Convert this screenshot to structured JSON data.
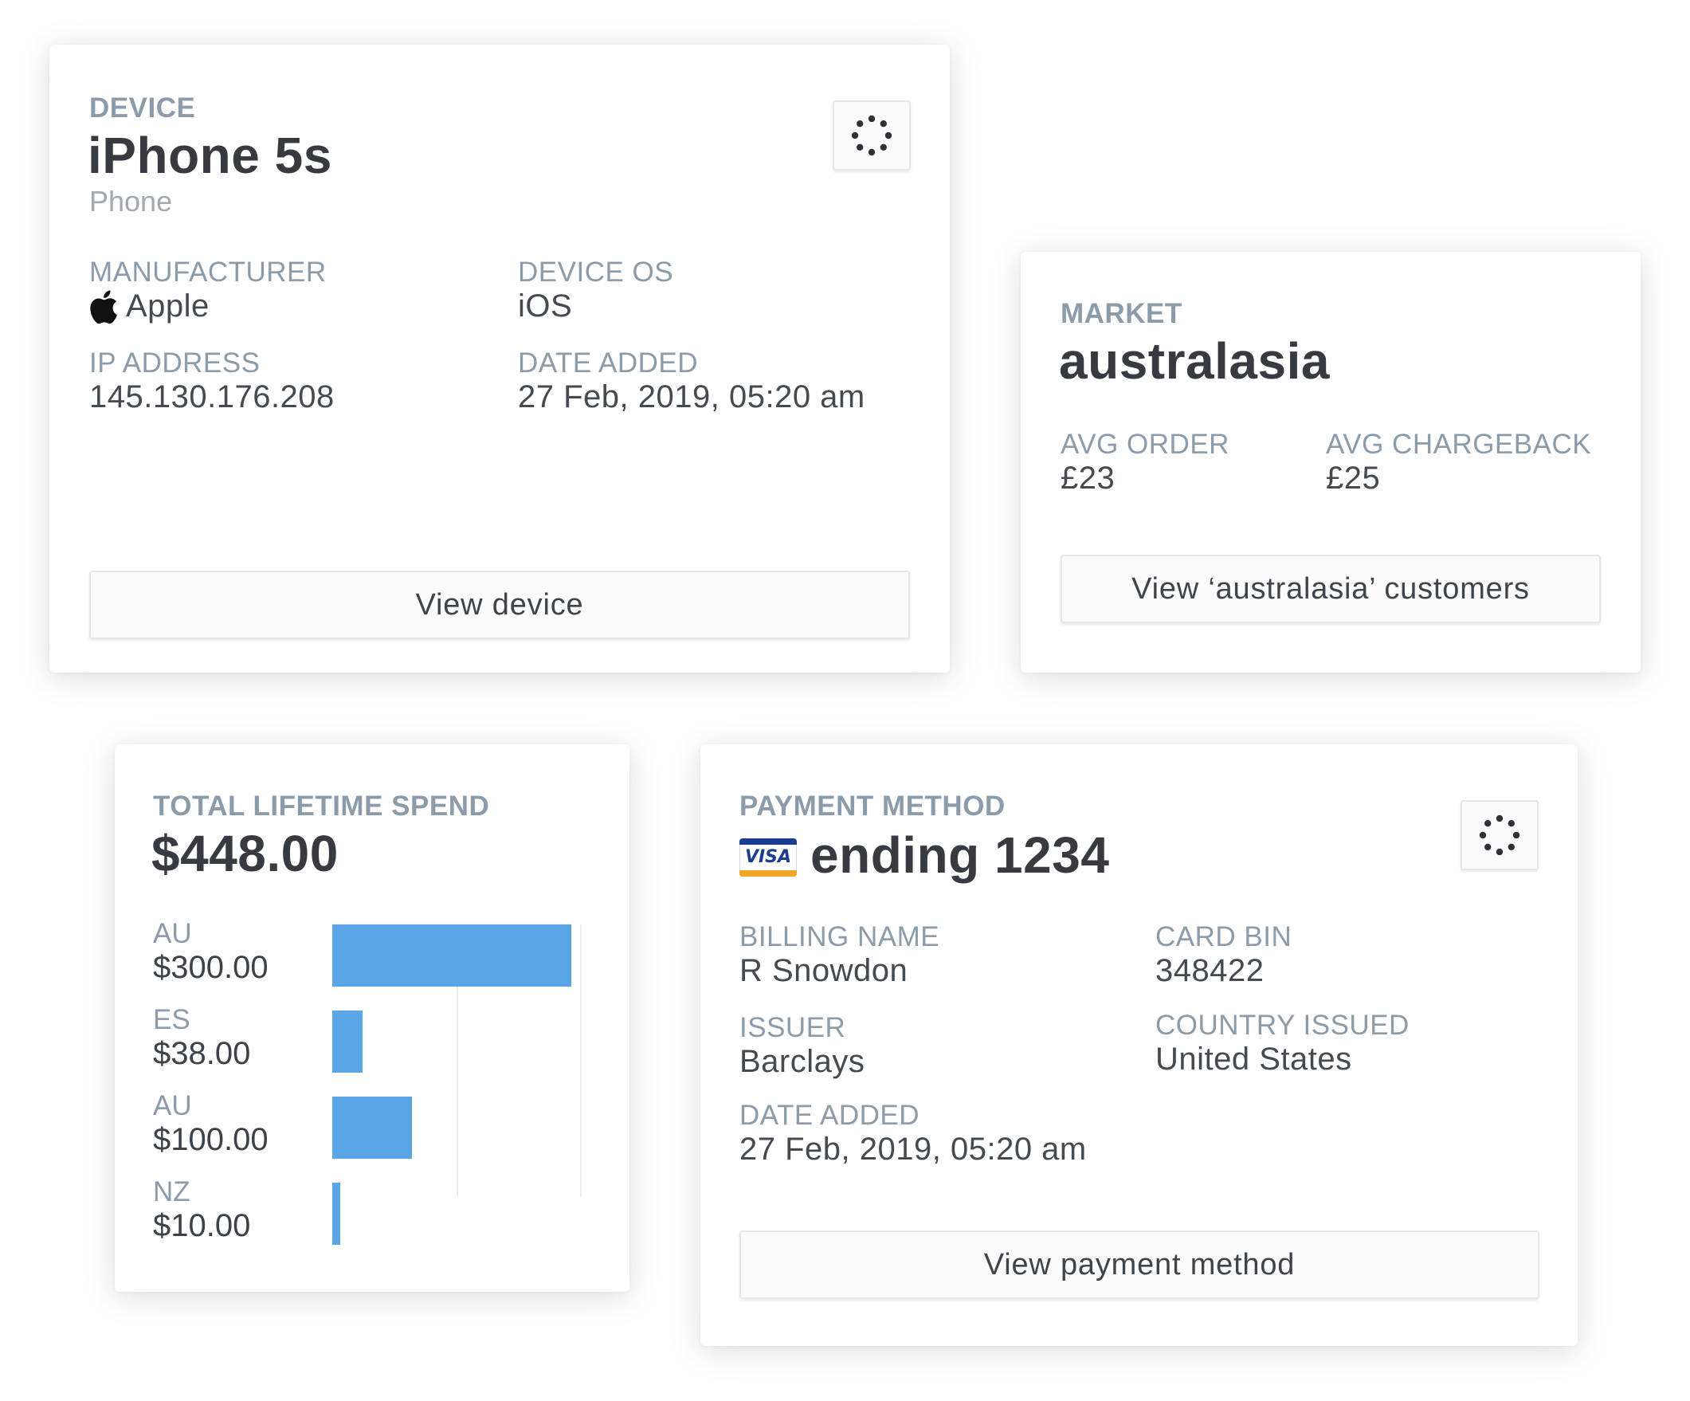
{
  "device_card": {
    "eyebrow": "DEVICE",
    "title": "iPhone 5s",
    "subtitle": "Phone",
    "action_icon": "loader-dots-icon",
    "fields": [
      {
        "label": "MANUFACTURER",
        "value": "Apple",
        "icon": "apple-icon"
      },
      {
        "label": "DEVICE OS",
        "value": "iOS"
      },
      {
        "label": "IP ADDRESS",
        "value": "145.130.176.208"
      },
      {
        "label": "DATE ADDED",
        "value": "27 Feb, 2019, 05:20 am"
      }
    ],
    "button_label": "View device"
  },
  "market_card": {
    "eyebrow": "MARKET",
    "title": "australasia",
    "fields": [
      {
        "label": "AVG ORDER",
        "value": "£23"
      },
      {
        "label": "AVG CHARGEBACK",
        "value": "£25"
      }
    ],
    "button_label": "View ‘australasia’ customers"
  },
  "spend_card": {
    "eyebrow": "TOTAL LIFETIME SPEND",
    "total": "$448.00",
    "bar_color": "#5aa5e6"
  },
  "chart_data": {
    "type": "bar",
    "orientation": "horizontal",
    "categories": [
      "AU",
      "ES",
      "AU",
      "NZ"
    ],
    "value_labels": [
      "$300.00",
      "$38.00",
      "$100.00",
      "$10.00"
    ],
    "values": [
      300,
      38,
      100,
      10
    ],
    "xlim": [
      0,
      300
    ],
    "grid": true,
    "title": "",
    "xlabel": "",
    "ylabel": ""
  },
  "payment_card": {
    "eyebrow": "PAYMENT METHOD",
    "card_brand_icon": "visa-card-icon",
    "card_brand_text": "VISA",
    "title": "ending 1234",
    "action_icon": "loader-dots-icon",
    "fields": [
      {
        "label": "BILLING NAME",
        "value": "R Snowdon"
      },
      {
        "label": "CARD BIN",
        "value": "348422"
      },
      {
        "label": "ISSUER",
        "value": "Barclays"
      },
      {
        "label": "COUNTRY ISSUED",
        "value": "United States"
      },
      {
        "label": "DATE ADDED",
        "value": "27 Feb, 2019, 05:20 am"
      }
    ],
    "button_label": "View payment method"
  },
  "colors": {
    "accent_bar": "#5aa5e6",
    "label": "#8c9ba9",
    "heading": "#373b41",
    "visa_blue": "#1a3d8f",
    "visa_gold": "#f2a623"
  }
}
